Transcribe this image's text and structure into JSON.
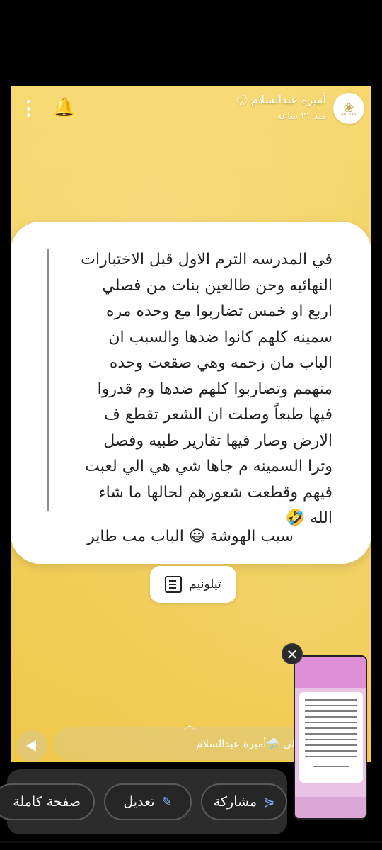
{
  "story": {
    "author": "أميرة عبدالسلام",
    "time_ago": "منذ ٢١ ساعة",
    "brand_text": "ARDIAS"
  },
  "post": {
    "lines": [
      "في المدرسه الترم الاول قبل الاختبارات",
      "النهائيه وحن طالعين بنات من فصلي",
      "اربع او خمس تضاربوا مع وحده مره",
      "سمينه كلهم كانوا ضدها والسبب ان",
      "الباب مان زحمه وهي صقعت وحده",
      "منهمم وتضاربوا كلهم ضدها وم قدروا",
      "فيها طبعاً وصلت ان الشعر تقطع ف",
      "الارض وصار فيها تقارير طبيه وفصل",
      "وترا السمينه م جاها شي هي الي لعبت",
      "فيهم وقطعت شعورهم لحالها ما شاء",
      "الله 🤣"
    ],
    "tagline": "سبب الهوشة 😀 الباب مب طاير",
    "source": "تيلونيم"
  },
  "reply": {
    "text": "رد على 🌧️أميرة عبدالسلام"
  },
  "actions": {
    "share": "مشاركة",
    "edit": "تعديل",
    "full_page": "صفحة كاملة"
  },
  "colors": {
    "story_bg": "#f3d160",
    "accent": "#7fb4ff"
  }
}
